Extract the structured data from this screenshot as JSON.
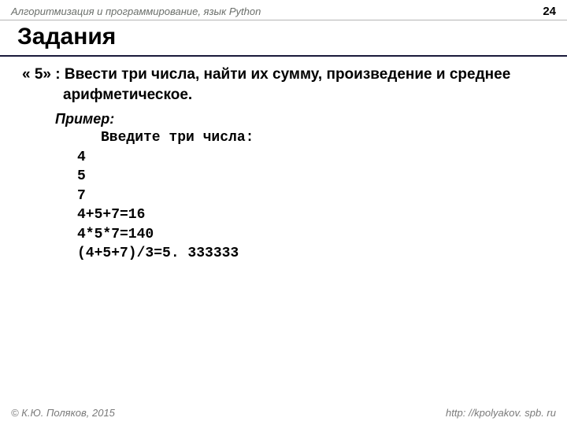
{
  "header": {
    "subject": "Алгоритмизация и программирование, язык Python",
    "page_no": "24"
  },
  "title": "Задания",
  "task": {
    "label": "« 5» :",
    "text": "Ввести три числа, найти их сумму, произведение и среднее арифметическое."
  },
  "example": {
    "label": "Пример:",
    "prompt": "Введите три числа:",
    "lines": {
      "l1": "4",
      "l2": "5",
      "l3": "7",
      "l4": "4+5+7=16",
      "l5": "4*5*7=140",
      "l6": "(4+5+7)/3=5. 333333"
    }
  },
  "footer": {
    "copyright": "© К.Ю. Поляков, 2015",
    "url": "http: //kpolyakov. spb. ru"
  }
}
